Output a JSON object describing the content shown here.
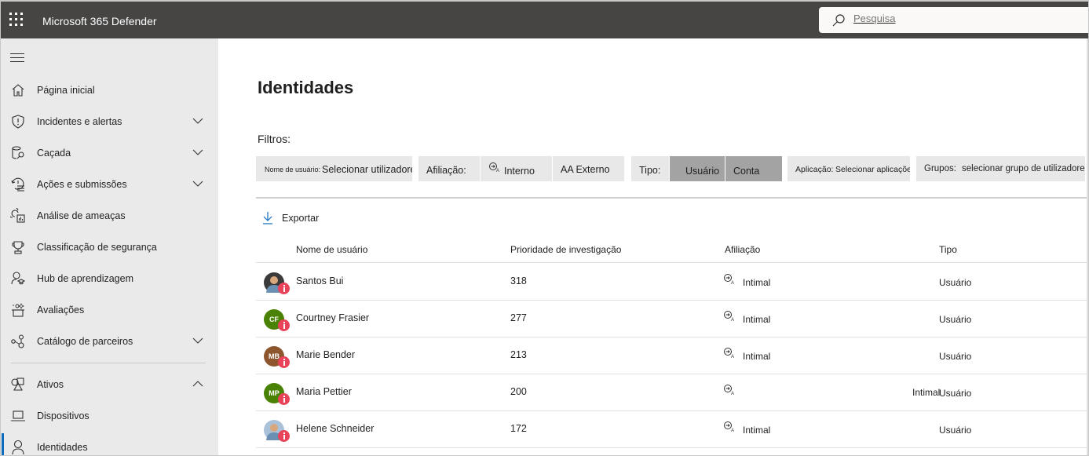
{
  "app": {
    "title": "Microsoft 365 Defender"
  },
  "search": {
    "placeholder": "Pesquisa"
  },
  "sidebar": {
    "items": [
      {
        "label": "Página inicial",
        "icon": "home-icon",
        "expandable": false
      },
      {
        "label": "Incidentes e alertas",
        "icon": "shield-alert-icon",
        "expandable": true
      },
      {
        "label": "Caçada",
        "icon": "hunting-icon",
        "expandable": true
      },
      {
        "label": "Ações e submissões",
        "icon": "history-list-icon",
        "expandable": true
      },
      {
        "label": "Análise de ameaças",
        "icon": "threat-analytics-icon",
        "expandable": false
      },
      {
        "label": "Classificação de segurança",
        "icon": "trophy-icon",
        "expandable": false
      },
      {
        "label": "Hub de aprendizagem",
        "icon": "learning-hub-icon",
        "expandable": false
      },
      {
        "label": "Avaliações",
        "icon": "evaluation-icon",
        "expandable": false
      },
      {
        "label": "Catálogo de parceiros",
        "icon": "partner-catalog-icon",
        "expandable": true
      },
      {
        "label": "Ativos",
        "icon": "assets-icon",
        "expandable": true,
        "expanded": true
      },
      {
        "label": "Dispositivos",
        "icon": "laptop-icon",
        "expandable": false
      },
      {
        "label": "Identidades",
        "icon": "person-icon",
        "expandable": false,
        "active": true
      }
    ]
  },
  "page": {
    "title": "Identidades",
    "filters_label": "Filtros:",
    "filters": {
      "username": {
        "label": "Nome de usuário:",
        "value": "Selecionar utilizadores"
      },
      "affiliation": {
        "label": "Afiliação:",
        "options": [
          "Interno",
          "AA Externo"
        ]
      },
      "type": {
        "label": "Tipo:",
        "options": [
          "Usuário",
          "Conta"
        ]
      },
      "application": {
        "label": "Aplicação:",
        "value": "Selecionar aplicações"
      },
      "groups": {
        "label": "Grupos:",
        "value": "selecionar grupo de utilizadores"
      }
    },
    "export_label": "Exportar"
  },
  "table": {
    "columns": [
      "Nome de usuário",
      "Prioridade de investigação",
      "Afiliação",
      "Tipo"
    ],
    "rows": [
      {
        "name": "Santos Bui",
        "initials": "",
        "avatar_type": "photo",
        "avatar_color": "#3a3a3a",
        "priority": "318",
        "affiliation": "Intimal",
        "type": "Usuário"
      },
      {
        "name": "Courtney Frasier",
        "initials": "CF",
        "avatar_type": "initials",
        "avatar_color": "#498205",
        "priority": "277",
        "affiliation": "Intimal",
        "type": "Usuário"
      },
      {
        "name": "Marie Bender",
        "initials": "MB",
        "avatar_type": "initials",
        "avatar_color": "#8e562e",
        "priority": "213",
        "affiliation": "Intimal",
        "type": "Usuário"
      },
      {
        "name": "Maria Pettier",
        "initials": "MP",
        "avatar_type": "initials",
        "avatar_color": "#498205",
        "priority": "200",
        "affiliation": "Intimal",
        "type": "Usuário"
      },
      {
        "name": "Helene Schneider",
        "initials": "",
        "avatar_type": "photo",
        "avatar_color": "#a9c1d9",
        "priority": "172",
        "affiliation": "Intimal",
        "type": "Usuário"
      }
    ]
  },
  "colors": {
    "topbar": "#464544",
    "sidebar": "#eaeaea",
    "accent": "#0f6cbd",
    "alert_badge": "#e9435a",
    "filter_bg": "#e8e8e8",
    "filter_selected": "#a3a3a3"
  }
}
